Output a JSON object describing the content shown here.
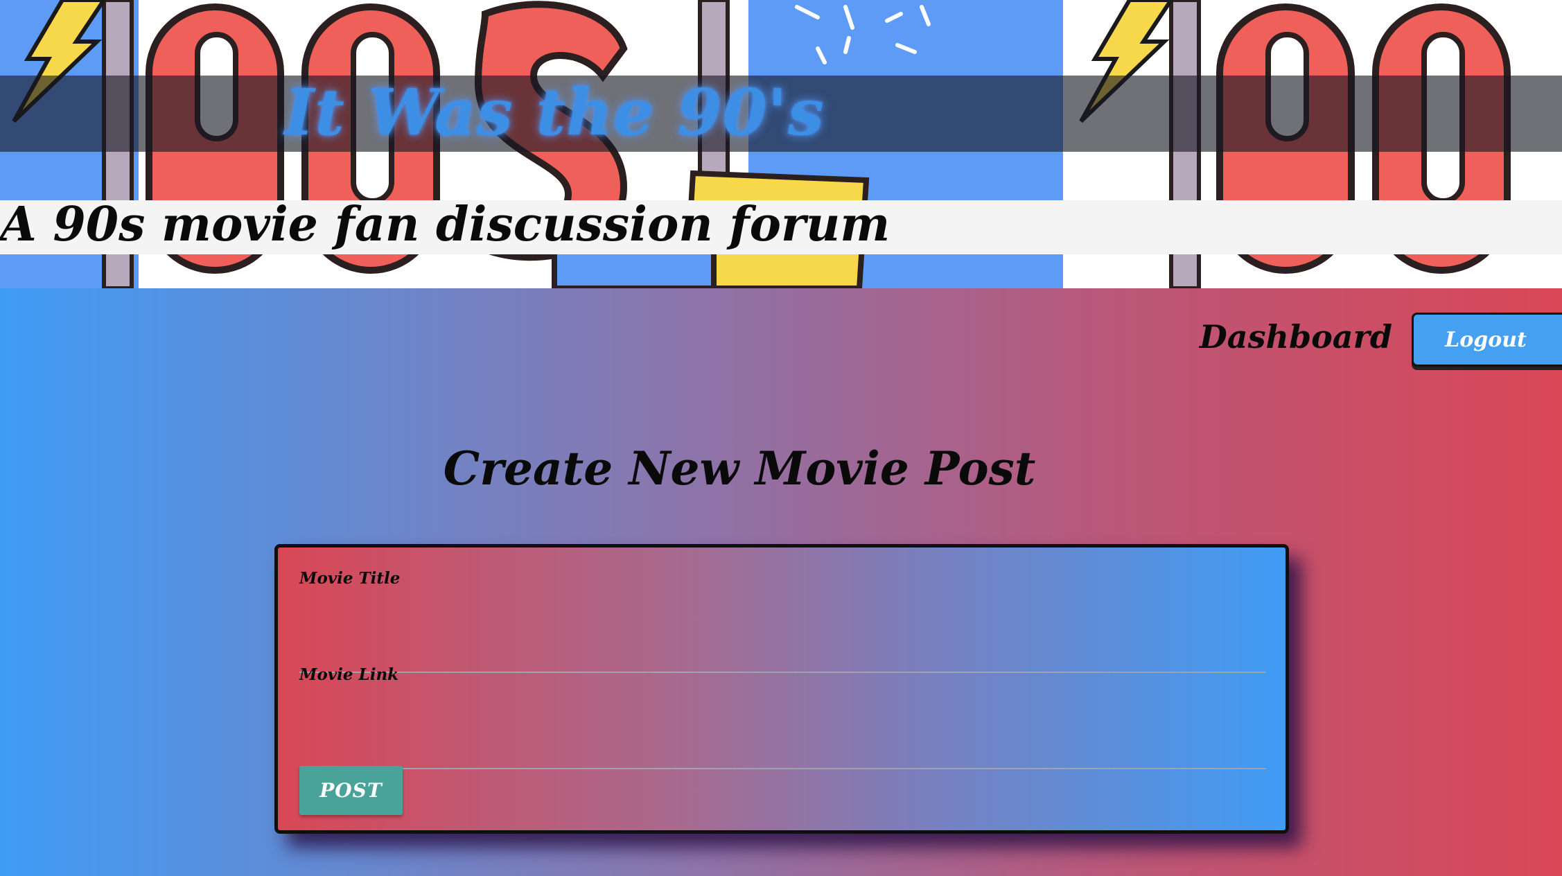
{
  "header": {
    "site_title": "It Was the 90's",
    "tagline": "A 90s movie fan discussion forum"
  },
  "nav": {
    "dashboard_label": "Dashboard",
    "logout_label": "Logout"
  },
  "main": {
    "heading": "Create New Movie Post"
  },
  "form": {
    "title_label": "Movie Title",
    "title_value": "",
    "link_label": "Movie Link",
    "link_value": "",
    "submit_label": "POST"
  },
  "colors": {
    "gradient_blue": "#3f9cf5",
    "gradient_red": "#d94756",
    "logout_button": "#45a0f2",
    "post_button": "#4aa398",
    "title_glow": "#3d8fe6"
  }
}
